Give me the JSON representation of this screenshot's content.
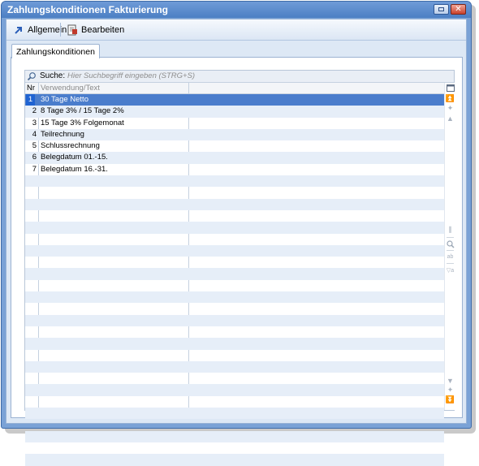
{
  "window": {
    "title": "Zahlungskonditionen Fakturierung"
  },
  "toolbar": {
    "general_label": "Allgemein",
    "edit_label": "Bearbeiten"
  },
  "tab": {
    "label": "Zahlungskonditionen"
  },
  "search": {
    "label": "Suche:",
    "placeholder": "Hier Suchbegriff eingeben (STRG+S)"
  },
  "grid": {
    "headers": {
      "nr": "Nr",
      "text": "Verwendung/Text"
    },
    "rows": [
      {
        "nr": "1",
        "text": "30 Tage Netto",
        "selected": true
      },
      {
        "nr": "2",
        "text": "8 Tage 3% / 15 Tage 2%"
      },
      {
        "nr": "3",
        "text": "15 Tage 3% Folgemonat"
      },
      {
        "nr": "4",
        "text": "Teilrechnung"
      },
      {
        "nr": "5",
        "text": "Schlussrechnung"
      },
      {
        "nr": "6",
        "text": "Belegdatum 01.-15."
      },
      {
        "nr": "7",
        "text": "Belegdatum 16.-31."
      }
    ]
  },
  "colors": {
    "selection": "#4a7dcc",
    "title_bar": "#5a8ad0",
    "alt_row": "#e6eef8"
  }
}
